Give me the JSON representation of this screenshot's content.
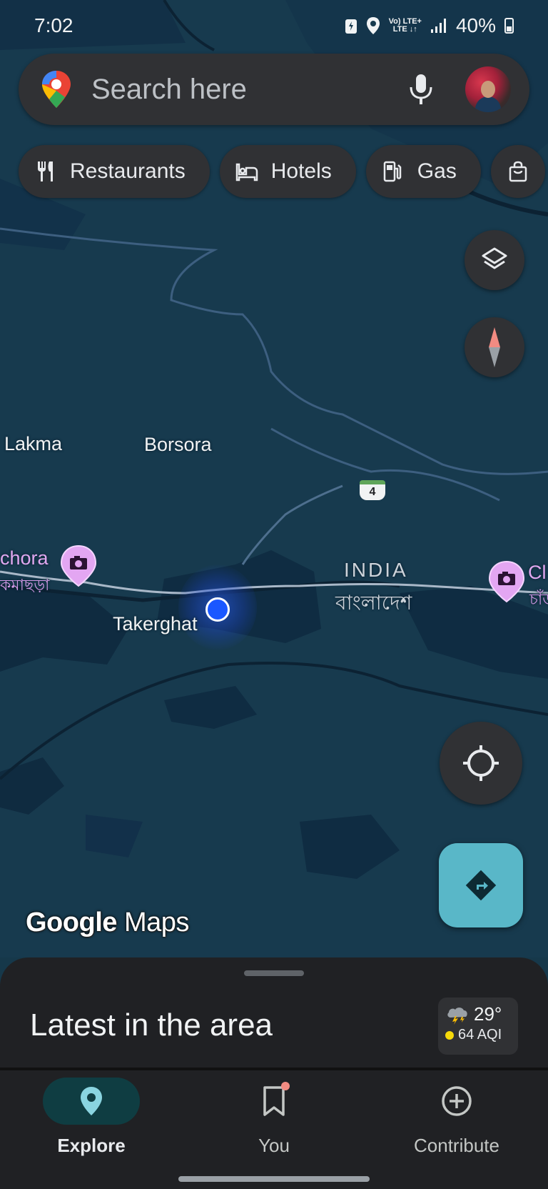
{
  "status_bar": {
    "time": "7:02",
    "network_line1": "Vo) LTE+",
    "network_line2": "LTE ↓↑",
    "battery_percent": "40%"
  },
  "search": {
    "placeholder": "Search here",
    "icons": [
      "google-maps-pin-icon",
      "microphone-icon",
      "avatar"
    ]
  },
  "chips": [
    {
      "label": "Restaurants",
      "icon": "fork-knife-icon"
    },
    {
      "label": "Hotels",
      "icon": "bed-icon"
    },
    {
      "label": "Gas",
      "icon": "gas-pump-icon"
    },
    {
      "label": "",
      "icon": "shopping-bag-icon"
    }
  ],
  "map": {
    "labels": {
      "lakma": "Lakma",
      "borsora": "Borsora",
      "chora": "chora",
      "chora_bn": "কমাছড়া",
      "india": "INDIA",
      "bangladesh_bn": "বাংলাদেশ",
      "takerghat": "Takerghat",
      "cl": "Cl",
      "cl_bn": "চাঁড"
    },
    "route_shield": "4",
    "colors": {
      "water": "#16384a",
      "land_dark": "#0f2f45",
      "border_line": "#8aa0b8",
      "location_dot": "#1a57ff"
    }
  },
  "brand": {
    "google": "Google",
    "maps": "Maps"
  },
  "sheet": {
    "title": "Latest in the area",
    "weather_temp": "29°",
    "weather_aqi": "64 AQI"
  },
  "nav": {
    "explore": "Explore",
    "you": "You",
    "contribute": "Contribute"
  },
  "accent": {
    "directions_fab": "#59b7c8",
    "explore_active_bg": "#0f3d42"
  }
}
